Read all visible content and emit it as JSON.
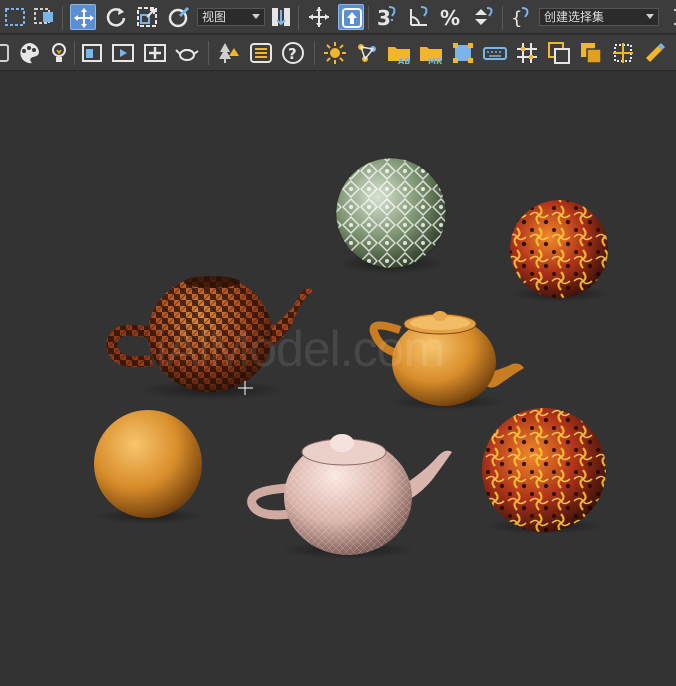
{
  "toolbar_top": {
    "view_dropdown": {
      "selected": "视图"
    },
    "selection_set_dropdown": {
      "selected": "创建选择集"
    },
    "snap_label": "3",
    "angle_snap_label": "",
    "percent_snap_label": "%"
  },
  "toolbar_bottom": {
    "folder_ab_label": "AB",
    "folder_mr_label": "MR"
  },
  "viewport": {
    "watermark": "iAlModel.com",
    "objects": [
      {
        "type": "sphere",
        "material": "green-white-kaleidoscope"
      },
      {
        "type": "sphere",
        "material": "flame-kaleidoscope"
      },
      {
        "type": "teapot",
        "material": "orange-black-pattern"
      },
      {
        "type": "teapot",
        "material": "golden-orange"
      },
      {
        "type": "sphere",
        "material": "golden-orange"
      },
      {
        "type": "teapot",
        "material": "pink-white"
      },
      {
        "type": "sphere",
        "material": "flame-kaleidoscope"
      }
    ]
  },
  "colors": {
    "background": "#333333",
    "toolbar": "#3c3c3c",
    "active_button": "#5b8fd1",
    "accent_yellow": "#f2b62b",
    "accent_blue": "#7ab4e8"
  }
}
